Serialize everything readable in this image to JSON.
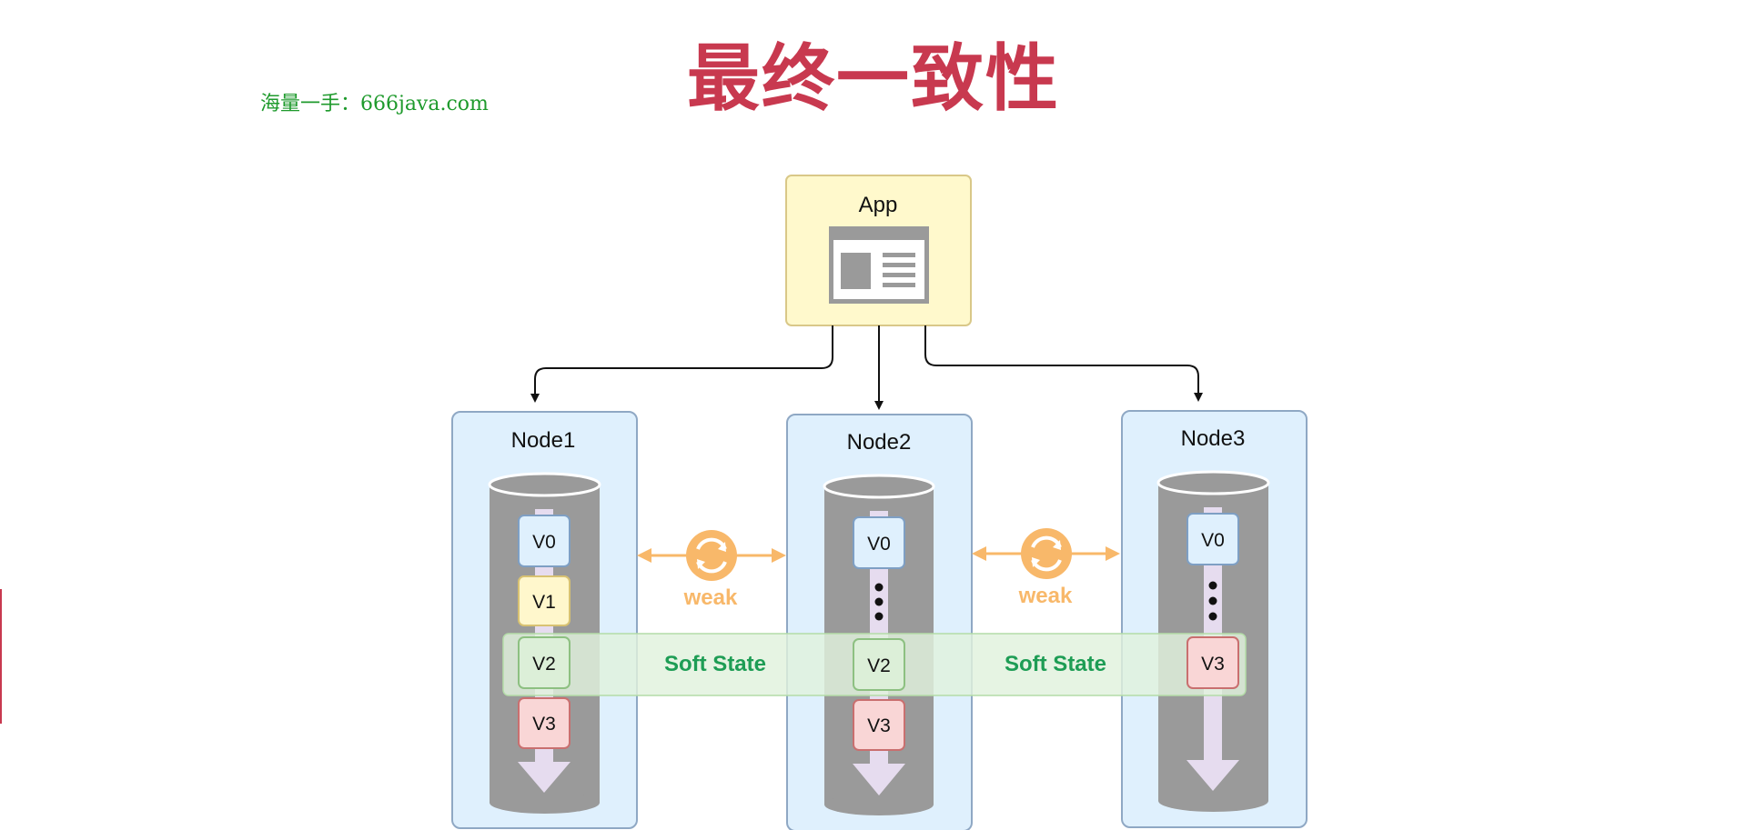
{
  "title": "最终一致性",
  "watermark": "海量一手：666java.com",
  "app": {
    "label": "App"
  },
  "nodes": [
    {
      "label": "Node1",
      "versions": [
        "V0",
        "V1",
        "V2",
        "V3"
      ]
    },
    {
      "label": "Node2",
      "versions": [
        "V0",
        "V2",
        "V3"
      ]
    },
    {
      "label": "Node3",
      "versions": [
        "V0",
        "V3"
      ]
    }
  ],
  "sync_labels": [
    "weak",
    "weak"
  ],
  "soft_state_labels": [
    "Soft State",
    "Soft State"
  ],
  "colors": {
    "title": "#c8394f",
    "watermark": "#1e9a2c",
    "app_fill": "#fff9cc",
    "node_fill": "#dff0fd",
    "cylinder": "#9a9a9a",
    "weak": "#f8b86a",
    "soft_state": "#1e9d55",
    "v0_fill": "#dff0fd",
    "v1_fill": "#fff7cc",
    "v2_fill": "#dcefd8",
    "v3_fill": "#f9d6d6"
  }
}
